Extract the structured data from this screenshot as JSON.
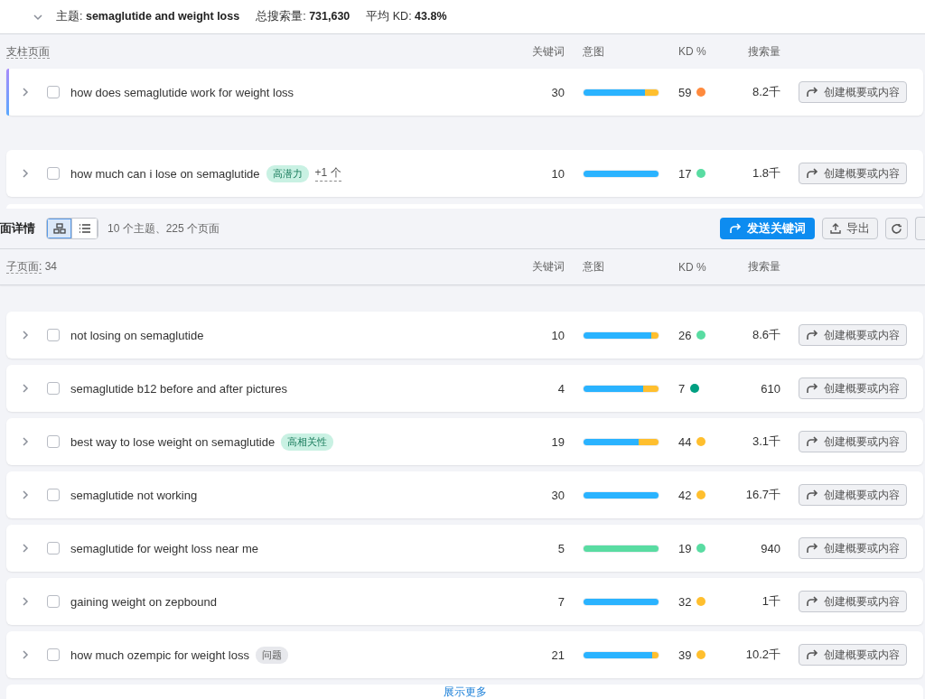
{
  "topic": {
    "expanded": true,
    "label": "主题:",
    "name": "semaglutide and weight loss",
    "volume_label": "总搜索量:",
    "volume": "731,630",
    "kd_label": "平均 KD:",
    "kd": "43.8%"
  },
  "pillar": {
    "title": "支柱页面",
    "columns": [
      "关键词",
      "意图",
      "KD %",
      "搜索量"
    ],
    "rows": [
      {
        "keyword": "how does semaglutide work for weight loss",
        "tags": [],
        "count": "30",
        "intent": {
          "level": 0.82,
          "color": "#2ab3ff"
        },
        "kd": {
          "text": "59",
          "color": "#ff8a3d"
        },
        "volume": "8.2千",
        "action": "创建概要或内容",
        "checked": false,
        "highlighted": true
      },
      {
        "keyword": "how much can i lose on semaglutide",
        "tags": [
          {
            "kind": "green",
            "text": "高潜力"
          }
        ],
        "more": "+1 个",
        "count": "10",
        "intent": {
          "level": 1,
          "color": "#2ab3ff"
        },
        "kd": {
          "text": "17",
          "color": "#59dca2"
        },
        "volume": "1.8千",
        "action": "创建概要或内容",
        "checked": false,
        "highlighted": false
      }
    ]
  },
  "details": {
    "title": "面详情",
    "views": [
      {
        "kind": "grid",
        "selected": true
      },
      {
        "kind": "list",
        "selected": false
      }
    ],
    "summary": "10 个主题、225 个页面",
    "send": "发送关键词",
    "export": "导出"
  },
  "children": {
    "title": "子页面:",
    "count": "34",
    "columns": [
      "关键词",
      "意图",
      "KD %",
      "搜索量"
    ],
    "rows": [
      {
        "keyword": "not losing on semaglutide",
        "tags": [],
        "count": "10",
        "intent": {
          "level": 0.9,
          "color": "#2ab3ff"
        },
        "kd": {
          "text": "26",
          "color": "#59dca2"
        },
        "volume": "8.6千",
        "action": "创建概要或内容",
        "checked": false,
        "highlighted": false
      },
      {
        "keyword": "semaglutide b12 before and after pictures",
        "tags": [],
        "count": "4",
        "intent": {
          "level": 0.8,
          "color": "#2ab3ff"
        },
        "kd": {
          "text": "7",
          "color": "#009f81"
        },
        "volume": "610",
        "action": "创建概要或内容",
        "checked": false,
        "highlighted": false
      },
      {
        "keyword": "best way to lose weight on semaglutide",
        "tags": [
          {
            "kind": "green",
            "text": "高相关性"
          }
        ],
        "count": "19",
        "intent": {
          "level": 0.73,
          "color": "#2ab3ff"
        },
        "kd": {
          "text": "44",
          "color": "#ffbf2e"
        },
        "volume": "3.1千",
        "action": "创建概要或内容",
        "checked": false,
        "highlighted": false
      },
      {
        "keyword": "semaglutide not working",
        "tags": [],
        "count": "30",
        "intent": {
          "level": 1,
          "color": "#2ab3ff"
        },
        "kd": {
          "text": "42",
          "color": "#ffbf2e"
        },
        "volume": "16.7千",
        "action": "创建概要或内容",
        "checked": false,
        "highlighted": false
      },
      {
        "keyword": "semaglutide for weight loss near me",
        "tags": [],
        "count": "5",
        "intent": {
          "level": 1,
          "color": "#59dca2"
        },
        "kd": {
          "text": "19",
          "color": "#59dca2"
        },
        "volume": "940",
        "action": "创建概要或内容",
        "checked": false,
        "highlighted": false
      },
      {
        "keyword": "gaining weight on zepbound",
        "tags": [],
        "count": "7",
        "intent": {
          "level": 1,
          "color": "#2ab3ff"
        },
        "kd": {
          "text": "32",
          "color": "#ffbf2e"
        },
        "volume": "1千",
        "action": "创建概要或内容",
        "checked": false,
        "highlighted": false
      },
      {
        "keyword": "how much ozempic for weight loss",
        "tags": [
          {
            "kind": "grey",
            "text": "问题"
          }
        ],
        "count": "21",
        "intent": {
          "level": 0.92,
          "color": "#2ab3ff"
        },
        "kd": {
          "text": "39",
          "color": "#ffbf2e"
        },
        "volume": "10.2千",
        "action": "创建概要或内容",
        "checked": false,
        "highlighted": false
      }
    ],
    "show_more": "展示更多"
  }
}
